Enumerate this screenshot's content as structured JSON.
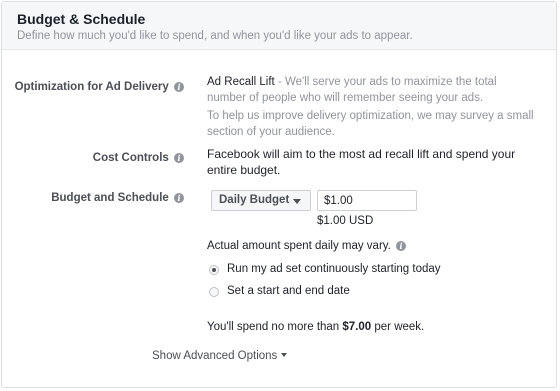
{
  "header": {
    "title": "Budget & Schedule",
    "subtitle": "Define how much you'd like to spend, and when you'd like your ads to appear."
  },
  "optimization": {
    "label": "Optimization for Ad Delivery",
    "value_name": "Ad Recall Lift",
    "value_desc": " - We'll serve your ads to maximize the total number of people who will remember seeing your ads.",
    "note": "To help us improve delivery optimization, we may survey a small section of your audience."
  },
  "cost_controls": {
    "label": "Cost Controls",
    "value": "Facebook will aim to the most ad recall lift and spend your entire budget."
  },
  "budget": {
    "label": "Budget and Schedule",
    "type_selected": "Daily Budget",
    "amount": "$1.00",
    "amount_display": "$1.00 USD",
    "note": "Actual amount spent daily may vary."
  },
  "schedule": {
    "options": [
      {
        "label": "Run my ad set continuously starting today",
        "checked": true
      },
      {
        "label": "Set a start and end date",
        "checked": false
      }
    ]
  },
  "summary": {
    "prefix": "You'll spend no more than ",
    "amount": "$7.00",
    "suffix": " per week."
  },
  "advanced": {
    "label": "Show Advanced Options"
  },
  "icons": {
    "info": "info-icon",
    "dropdown": "caret-down-icon"
  }
}
